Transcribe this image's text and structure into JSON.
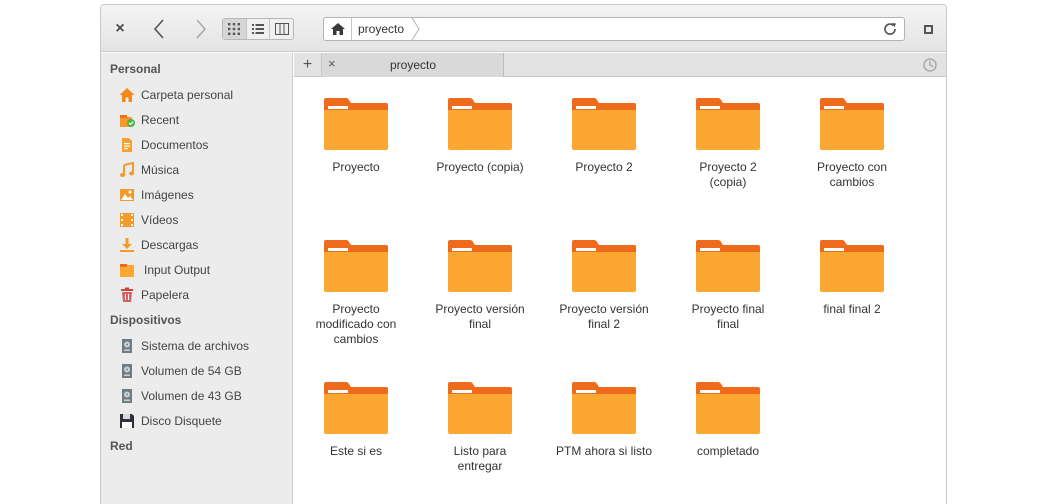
{
  "toolbar": {
    "close_icon": "close-icon",
    "back_icon": "chevron-left-icon",
    "forward_icon": "chevron-right-icon",
    "views": [
      "grid-view-icon",
      "list-view-icon",
      "column-view-icon"
    ],
    "path": "proyecto",
    "refresh_icon": "refresh-icon",
    "maximize_icon": "maximize-icon"
  },
  "sidebar": {
    "personal_header": "Personal",
    "personal_items": [
      {
        "label": "Carpeta personal",
        "icon": "home-icon"
      },
      {
        "label": "Recent",
        "icon": "recent-icon"
      },
      {
        "label": "Documentos",
        "icon": "document-icon"
      },
      {
        "label": "Música",
        "icon": "music-icon"
      },
      {
        "label": "Imágenes",
        "icon": "image-icon"
      },
      {
        "label": "Vídeos",
        "icon": "video-icon"
      },
      {
        "label": "Descargas",
        "icon": "download-icon"
      },
      {
        "label": "Input Output",
        "icon": "folder-icon"
      },
      {
        "label": "Papelera",
        "icon": "trash-icon"
      }
    ],
    "devices_header": "Dispositivos",
    "device_items": [
      {
        "label": "Sistema de archivos",
        "icon": "drive-icon"
      },
      {
        "label": "Volumen de 54 GB",
        "icon": "drive-icon"
      },
      {
        "label": "Volumen de 43 GB",
        "icon": "drive-icon"
      },
      {
        "label": "Disco Disquete",
        "icon": "floppy-icon"
      }
    ],
    "network_header": "Red"
  },
  "tabs": {
    "add_label": "+",
    "close_label": "×",
    "active_tab": "proyecto"
  },
  "folders": [
    [
      "Proyecto"
    ],
    [
      "Proyecto (copia)"
    ],
    [
      "Proyecto 2"
    ],
    [
      "Proyecto 2",
      "(copia)"
    ],
    [
      "Proyecto con",
      "cambios"
    ],
    [
      "Proyecto",
      "modificado con",
      "cambios"
    ],
    [
      "Proyecto versión",
      "final"
    ],
    [
      "Proyecto versión",
      "final 2"
    ],
    [
      "Proyecto final",
      "final"
    ],
    [
      "final final 2"
    ],
    [
      "Este si es"
    ],
    [
      "Listo para",
      "entregar"
    ],
    [
      "PTM ahora si listo"
    ],
    [
      "completado"
    ]
  ],
  "colors": {
    "folder_body": "#fca731",
    "folder_tab": "#ee6b1c",
    "folder_paper": "#ffffff"
  }
}
